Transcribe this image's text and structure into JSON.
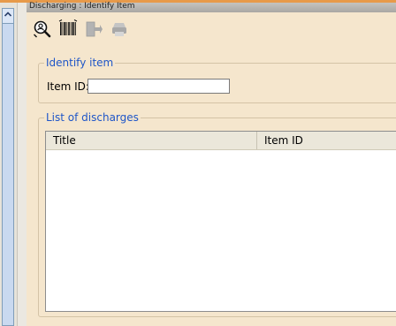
{
  "window": {
    "title": "Discharging : Identify Item"
  },
  "toolbar": {
    "buttons": [
      {
        "icon": "search-person-icon",
        "enabled": true
      },
      {
        "icon": "barcode-icon",
        "enabled": true
      },
      {
        "icon": "export-icon",
        "enabled": false
      },
      {
        "icon": "print-icon",
        "enabled": false
      }
    ]
  },
  "identify": {
    "legend": "Identify item",
    "item_id_label": "Item ID:",
    "item_id_value": ""
  },
  "discharges": {
    "legend": "List of discharges",
    "columns": [
      "Title",
      "Item ID"
    ],
    "rows": []
  },
  "colors": {
    "background": "#f5e6cd",
    "legend_text": "#1f56c8",
    "accent": "#e79a4a"
  }
}
